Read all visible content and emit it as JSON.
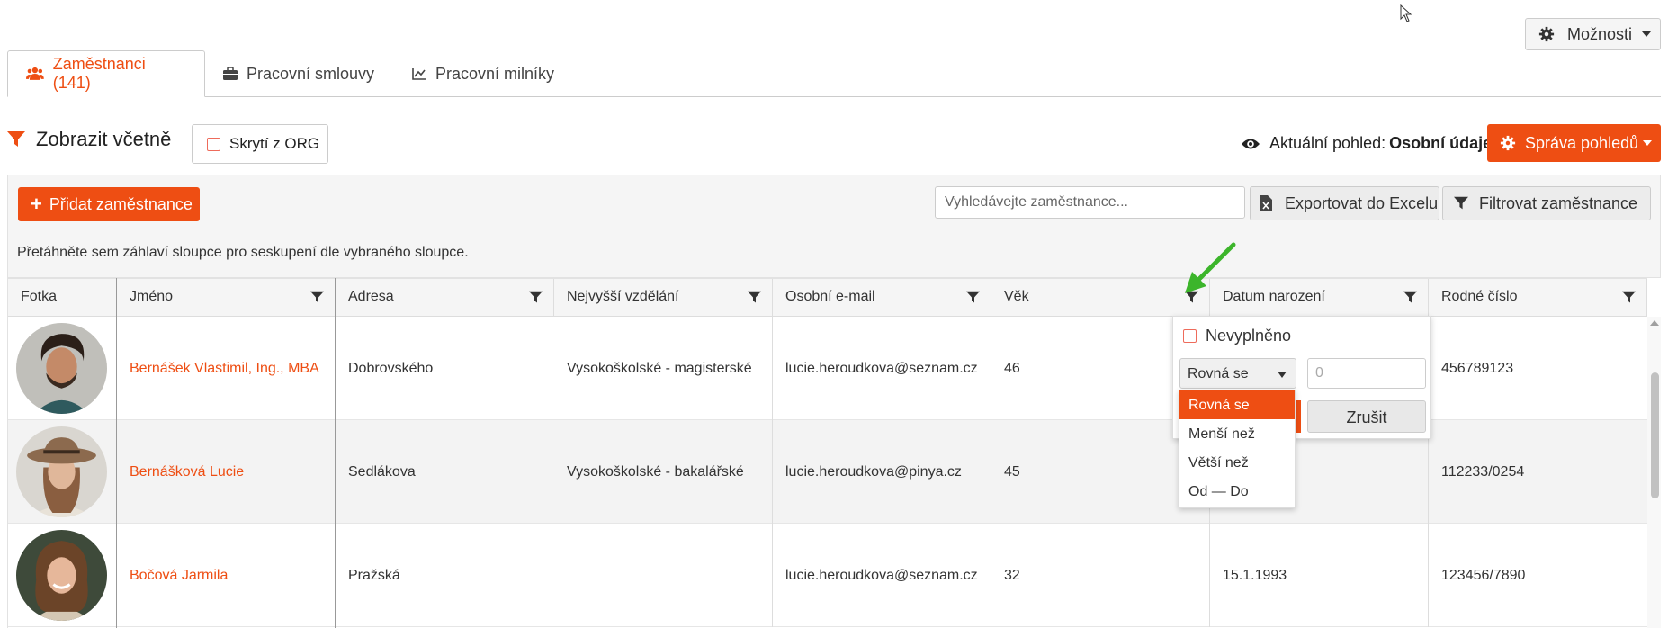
{
  "header": {
    "options_label": "Možnosti"
  },
  "tabs": [
    {
      "label": "Zaměstnanci (141)",
      "icon": "users-icon",
      "active": true
    },
    {
      "label": "Pracovní smlouvy",
      "icon": "briefcase-icon"
    },
    {
      "label": "Pracovní milníky",
      "icon": "line-chart-icon"
    }
  ],
  "filter_bar": {
    "title": "Zobrazit včetně",
    "hidden_org_label": "Skrytí z ORG",
    "current_view_label": "Aktuální pohled:",
    "current_view_value": "Osobní údaje",
    "manage_views_label": "Správa pohledů"
  },
  "toolbar": {
    "add_label": "Přidat zaměstnance",
    "search_placeholder": "Vyhledávejte zaměstnance...",
    "export_label": "Exportovat do Excelu",
    "filter_label": "Filtrovat zaměstnance"
  },
  "group_hint": "Přetáhněte sem záhlaví sloupce pro seskupení dle vybraného sloupce.",
  "columns": [
    "Fotka",
    "Jméno",
    "Adresa",
    "Nejvyšší vzdělání",
    "Osobní e-mail",
    "Věk",
    "Datum narození",
    "Rodné číslo"
  ],
  "rows": [
    {
      "name": "Bernášek Vlastimil, Ing., MBA",
      "address": "Dobrovského",
      "education": "Vysokoškolské - magisterské",
      "email": "lucie.heroudkova@seznam.cz",
      "age": "46",
      "birth": "",
      "rc": "456789123"
    },
    {
      "name": "Bernášková Lucie",
      "address": "Sedlákova",
      "education": "Vysokoškolské - bakalářské",
      "email": "lucie.heroudkova@pinya.cz",
      "age": "45",
      "birth": "",
      "rc": "112233/0254"
    },
    {
      "name": "Bočová Jarmila",
      "address": "Pražská",
      "education": "",
      "email": "lucie.heroudkova@seznam.cz",
      "age": "32",
      "birth": "15.1.1993",
      "rc": "123456/7890"
    }
  ],
  "popup": {
    "empty_label": "Nevyplněno",
    "operator_value": "Rovná se",
    "value_placeholder": "0",
    "cancel_label": "Zrušit",
    "operator_options": [
      "Rovná se",
      "Menší než",
      "Větší než",
      "Od — Do"
    ]
  },
  "colors": {
    "accent": "#ee4e13",
    "arrow": "#3cb52b"
  }
}
